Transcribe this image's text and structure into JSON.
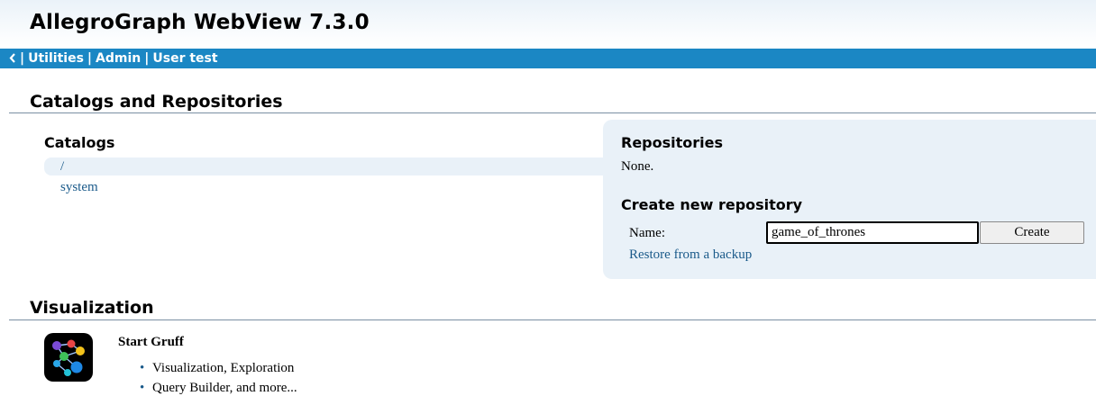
{
  "app": {
    "title": "AllegroGraph WebView 7.3.0"
  },
  "nav": {
    "back_icon": "chevron-left-icon",
    "separator": "|",
    "items": [
      {
        "label": "Utilities"
      },
      {
        "label": "Admin"
      },
      {
        "label": "User test"
      }
    ]
  },
  "catalogs_section": {
    "heading": "Catalogs and Repositories",
    "catalogs": {
      "heading": "Catalogs",
      "items": [
        {
          "label": "/",
          "selected": true
        },
        {
          "label": "system",
          "selected": false
        }
      ]
    },
    "repositories": {
      "heading": "Repositories",
      "empty_text": "None.",
      "create": {
        "heading": "Create new repository",
        "name_label": "Name:",
        "name_value": "game_of_thrones",
        "button_label": "Create",
        "restore_link": "Restore from a backup"
      }
    }
  },
  "visualization": {
    "heading": "Visualization",
    "gruff": {
      "icon": "gruff-logo-icon",
      "title": "Start Gruff",
      "bullets": [
        "Visualization, Exploration",
        "Query Builder, and more..."
      ]
    }
  },
  "colors": {
    "nav_bar": "#1b87c4",
    "link": "#1a5a8a",
    "panel_bg": "#e9f1f8"
  }
}
